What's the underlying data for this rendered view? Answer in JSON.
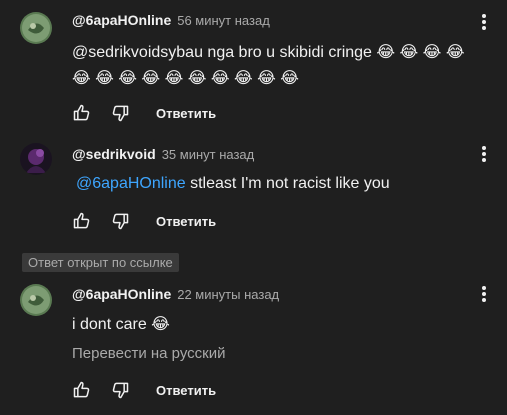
{
  "comments": [
    {
      "author": "@6apaHOnline",
      "time": "56 минут назад",
      "line1": "@sedrikvoidsybau nga bro u skibidi cringe 😂 😂 😂 😂",
      "line2": "😂 😂 😂 😂 😂 😂 😂 😂 😂 😂",
      "reply_label": "Ответить"
    },
    {
      "author": "@sedrikvoid",
      "time": "35 минут назад",
      "mention": "@6apaHOnline",
      "text": "stleast I'm not racist like you",
      "reply_label": "Ответить"
    },
    {
      "author": "@6apaHOnline",
      "time": "22 минуты назад",
      "text": "i dont care 😂",
      "translate_label": "Перевести на русский",
      "reply_label": "Ответить"
    }
  ],
  "badge": "Ответ открыт по ссылке",
  "icons": [
    "like-icon",
    "dislike-icon",
    "more-options-icon"
  ],
  "colors": {
    "background": "#1f1f1f",
    "mention": "#3ea6ff",
    "secondary": "#aaaaaa"
  }
}
